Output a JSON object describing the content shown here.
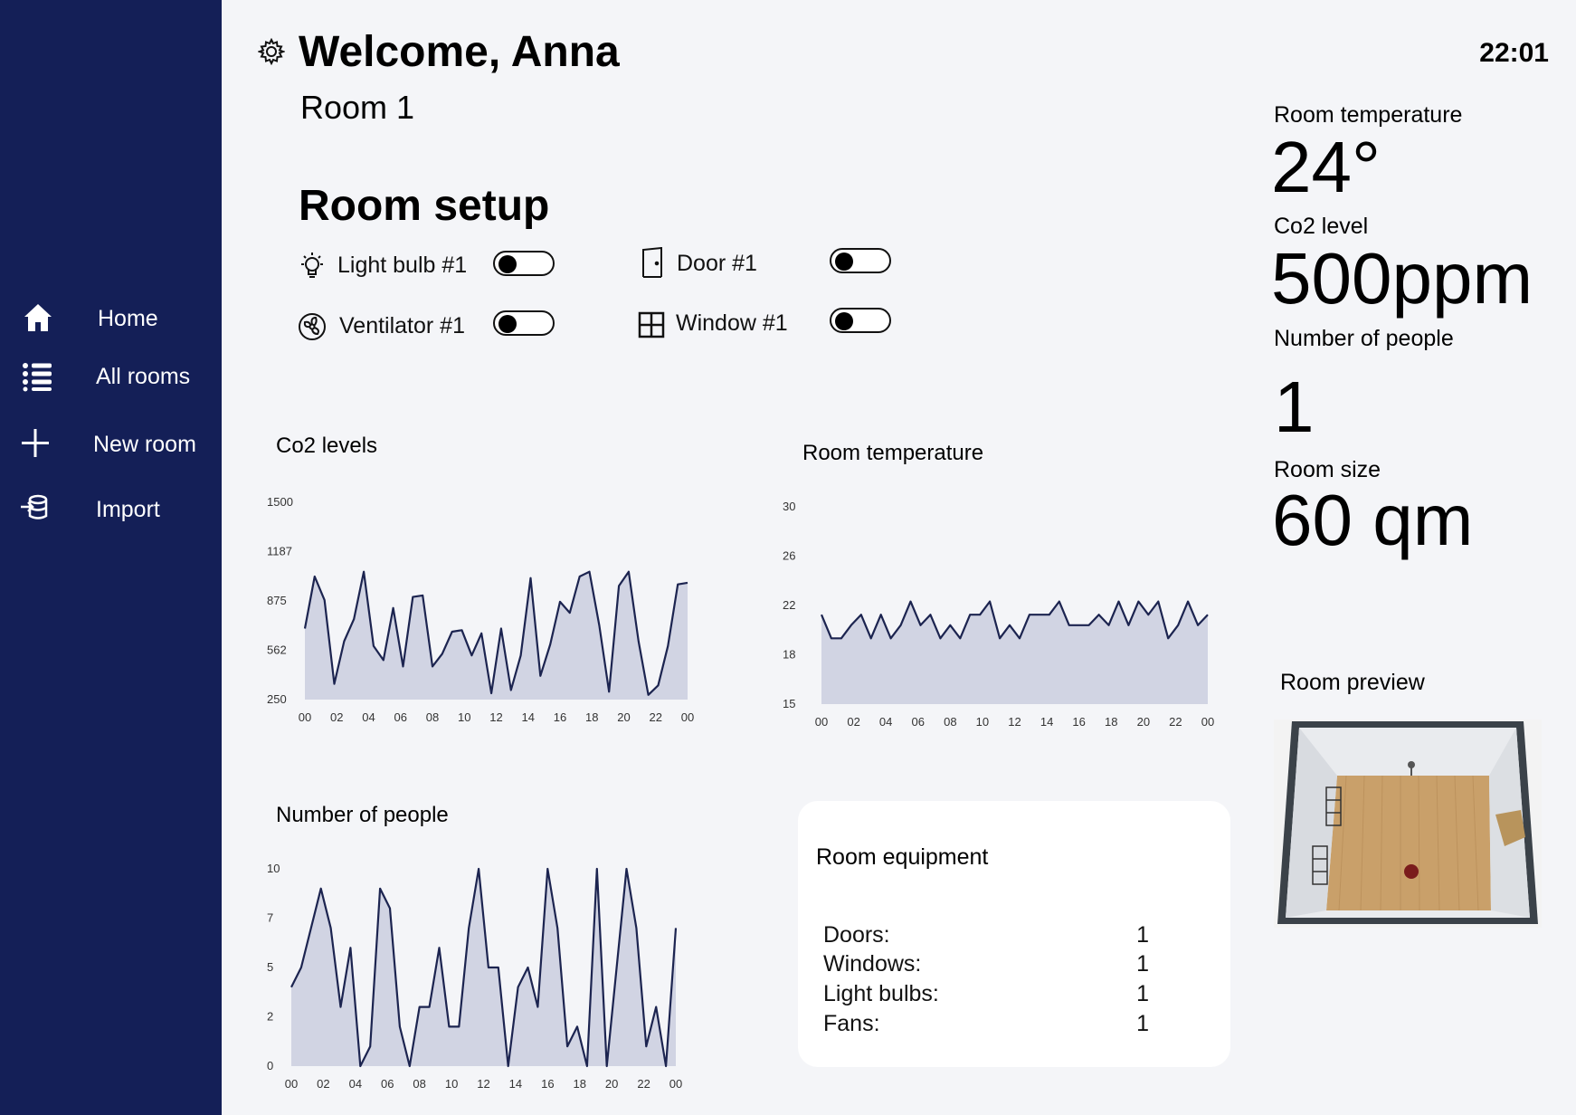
{
  "nav": {
    "items": [
      {
        "label": "Home",
        "icon": "home-icon"
      },
      {
        "label": "All rooms",
        "icon": "list-icon"
      },
      {
        "label": "New room",
        "icon": "plus-icon"
      },
      {
        "label": "Import",
        "icon": "import-icon"
      }
    ]
  },
  "header": {
    "welcome": "Welcome, Anna",
    "room_name": "Room 1",
    "time": "22:01"
  },
  "setup": {
    "title": "Room setup",
    "devices": [
      {
        "label": "Light bulb #1",
        "icon": "lightbulb-icon",
        "on": false
      },
      {
        "label": "Door #1",
        "icon": "door-icon",
        "on": false
      },
      {
        "label": "Ventilator #1",
        "icon": "fan-icon",
        "on": false
      },
      {
        "label": "Window #1",
        "icon": "window-icon",
        "on": false
      }
    ]
  },
  "stats": {
    "temperature_label": "Room temperature",
    "temperature_value": "24°",
    "co2_label": "Co2 level",
    "co2_value": "500ppm",
    "people_label": "Number of people",
    "people_value": "1",
    "size_label": "Room size",
    "size_value": "60 qm"
  },
  "preview": {
    "title": "Room preview"
  },
  "equipment": {
    "title": "Room equipment",
    "rows": [
      {
        "label": "Doors:",
        "value": "1"
      },
      {
        "label": "Windows:",
        "value": "1"
      },
      {
        "label": "Light bulbs:",
        "value": "1"
      },
      {
        "label": "Fans:",
        "value": "1"
      }
    ]
  },
  "colors": {
    "sidebar": "#141f57",
    "line": "#1c2450",
    "fill": "#d1d4e3",
    "background": "#f4f5f8"
  },
  "chart_data": [
    {
      "type": "area",
      "title": "Co2 levels",
      "yticks": [
        "1500",
        "1187",
        "875",
        "562",
        "250"
      ],
      "ylim": [
        250,
        1500
      ],
      "xticks": [
        "00",
        "02",
        "04",
        "06",
        "08",
        "10",
        "12",
        "14",
        "16",
        "18",
        "20",
        "22",
        "00"
      ],
      "grid": false,
      "series": [
        {
          "values": [
            700,
            1030,
            880,
            350,
            620,
            760,
            1060,
            590,
            500,
            830,
            460,
            900,
            910,
            460,
            540,
            680,
            690,
            530,
            670,
            290,
            700,
            310,
            530,
            1020,
            400,
            600,
            870,
            800,
            1030,
            1060,
            720,
            300,
            970,
            1060,
            620,
            280,
            340,
            590,
            980,
            990
          ]
        }
      ]
    },
    {
      "type": "area",
      "title": "Room temperature",
      "yticks": [
        "30",
        "26",
        "22",
        "18",
        "15"
      ],
      "ylim": [
        15,
        30
      ],
      "xticks": [
        "00",
        "02",
        "04",
        "06",
        "08",
        "10",
        "12",
        "14",
        "16",
        "18",
        "20",
        "22",
        "00"
      ],
      "grid": false,
      "series": [
        {
          "values": [
            21.8,
            20.0,
            20.0,
            21.0,
            21.8,
            20.0,
            21.8,
            20.0,
            21.0,
            22.8,
            21.0,
            21.8,
            20.0,
            21.0,
            20.0,
            21.8,
            21.8,
            22.8,
            20.0,
            21.0,
            20.0,
            21.8,
            21.8,
            21.8,
            22.8,
            21.0,
            21.0,
            21.0,
            21.8,
            21.0,
            22.8,
            21.0,
            22.8,
            21.8,
            22.8,
            20.0,
            21.0,
            22.8,
            21.0,
            21.8
          ]
        }
      ]
    },
    {
      "type": "area",
      "title": "Number of people",
      "yticks": [
        "10",
        "7",
        "5",
        "2",
        "0"
      ],
      "ylim": [
        0,
        10
      ],
      "xticks": [
        "00",
        "02",
        "04",
        "06",
        "08",
        "10",
        "12",
        "14",
        "16",
        "18",
        "20",
        "22",
        "00"
      ],
      "grid": false,
      "series": [
        {
          "values": [
            4,
            5,
            7,
            9,
            7,
            3,
            6,
            0,
            1,
            9,
            8,
            2,
            0,
            3,
            3,
            6,
            2,
            2,
            7,
            10,
            5,
            5,
            0,
            4,
            5,
            3,
            10,
            7,
            1,
            2,
            0,
            10,
            0,
            5,
            10,
            7,
            1,
            3,
            0,
            7
          ]
        }
      ]
    }
  ]
}
